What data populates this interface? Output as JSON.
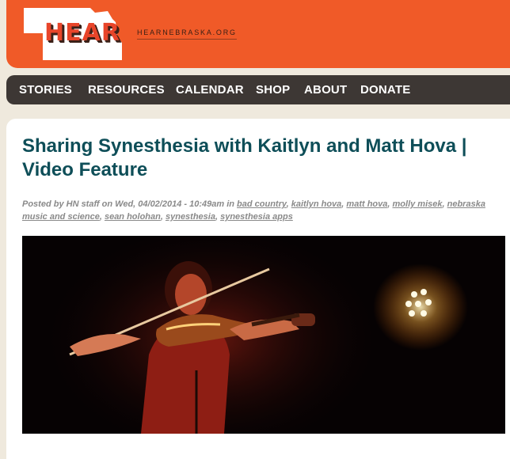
{
  "header": {
    "logo_text": "HEAR",
    "site_url": "HEARNEBRASKA.ORG"
  },
  "nav": {
    "items": [
      "STORIES",
      "RESOURCES",
      "CALENDAR",
      "SHOP",
      "ABOUT",
      "DONATE"
    ]
  },
  "article": {
    "title": "Sharing Synesthesia with Kaitlyn and Matt Hova | Video Feature",
    "meta_prefix": "Posted by HN staff on Wed, 04/02/2014 - 10:49am in",
    "tags": [
      "bad country",
      "kaitlyn hova",
      "matt hova",
      "molly misek",
      "nebraska music and science",
      "sean holohan",
      "synesthesia",
      "synesthesia apps"
    ]
  },
  "colors": {
    "brand_orange": "#f05a28",
    "nav_bg": "#3d3734",
    "title_teal": "#0e4e58",
    "page_bg": "#efe9dd"
  }
}
